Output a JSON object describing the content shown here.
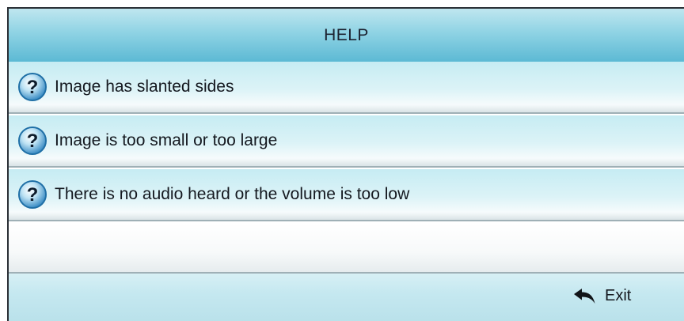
{
  "header": {
    "title": "HELP"
  },
  "help_items": [
    {
      "label": "Image has slanted sides",
      "icon": "question-icon"
    },
    {
      "label": "Image is too small or too large",
      "icon": "question-icon"
    },
    {
      "label": "There is no audio heard or the volume is too low",
      "icon": "question-icon"
    }
  ],
  "footer": {
    "exit_label": "Exit",
    "exit_icon": "return-arrow-icon"
  },
  "colors": {
    "header_blue": "#5cb9d4",
    "item_cyan": "#c6ecf3",
    "icon_blue": "#1f6fa6"
  }
}
